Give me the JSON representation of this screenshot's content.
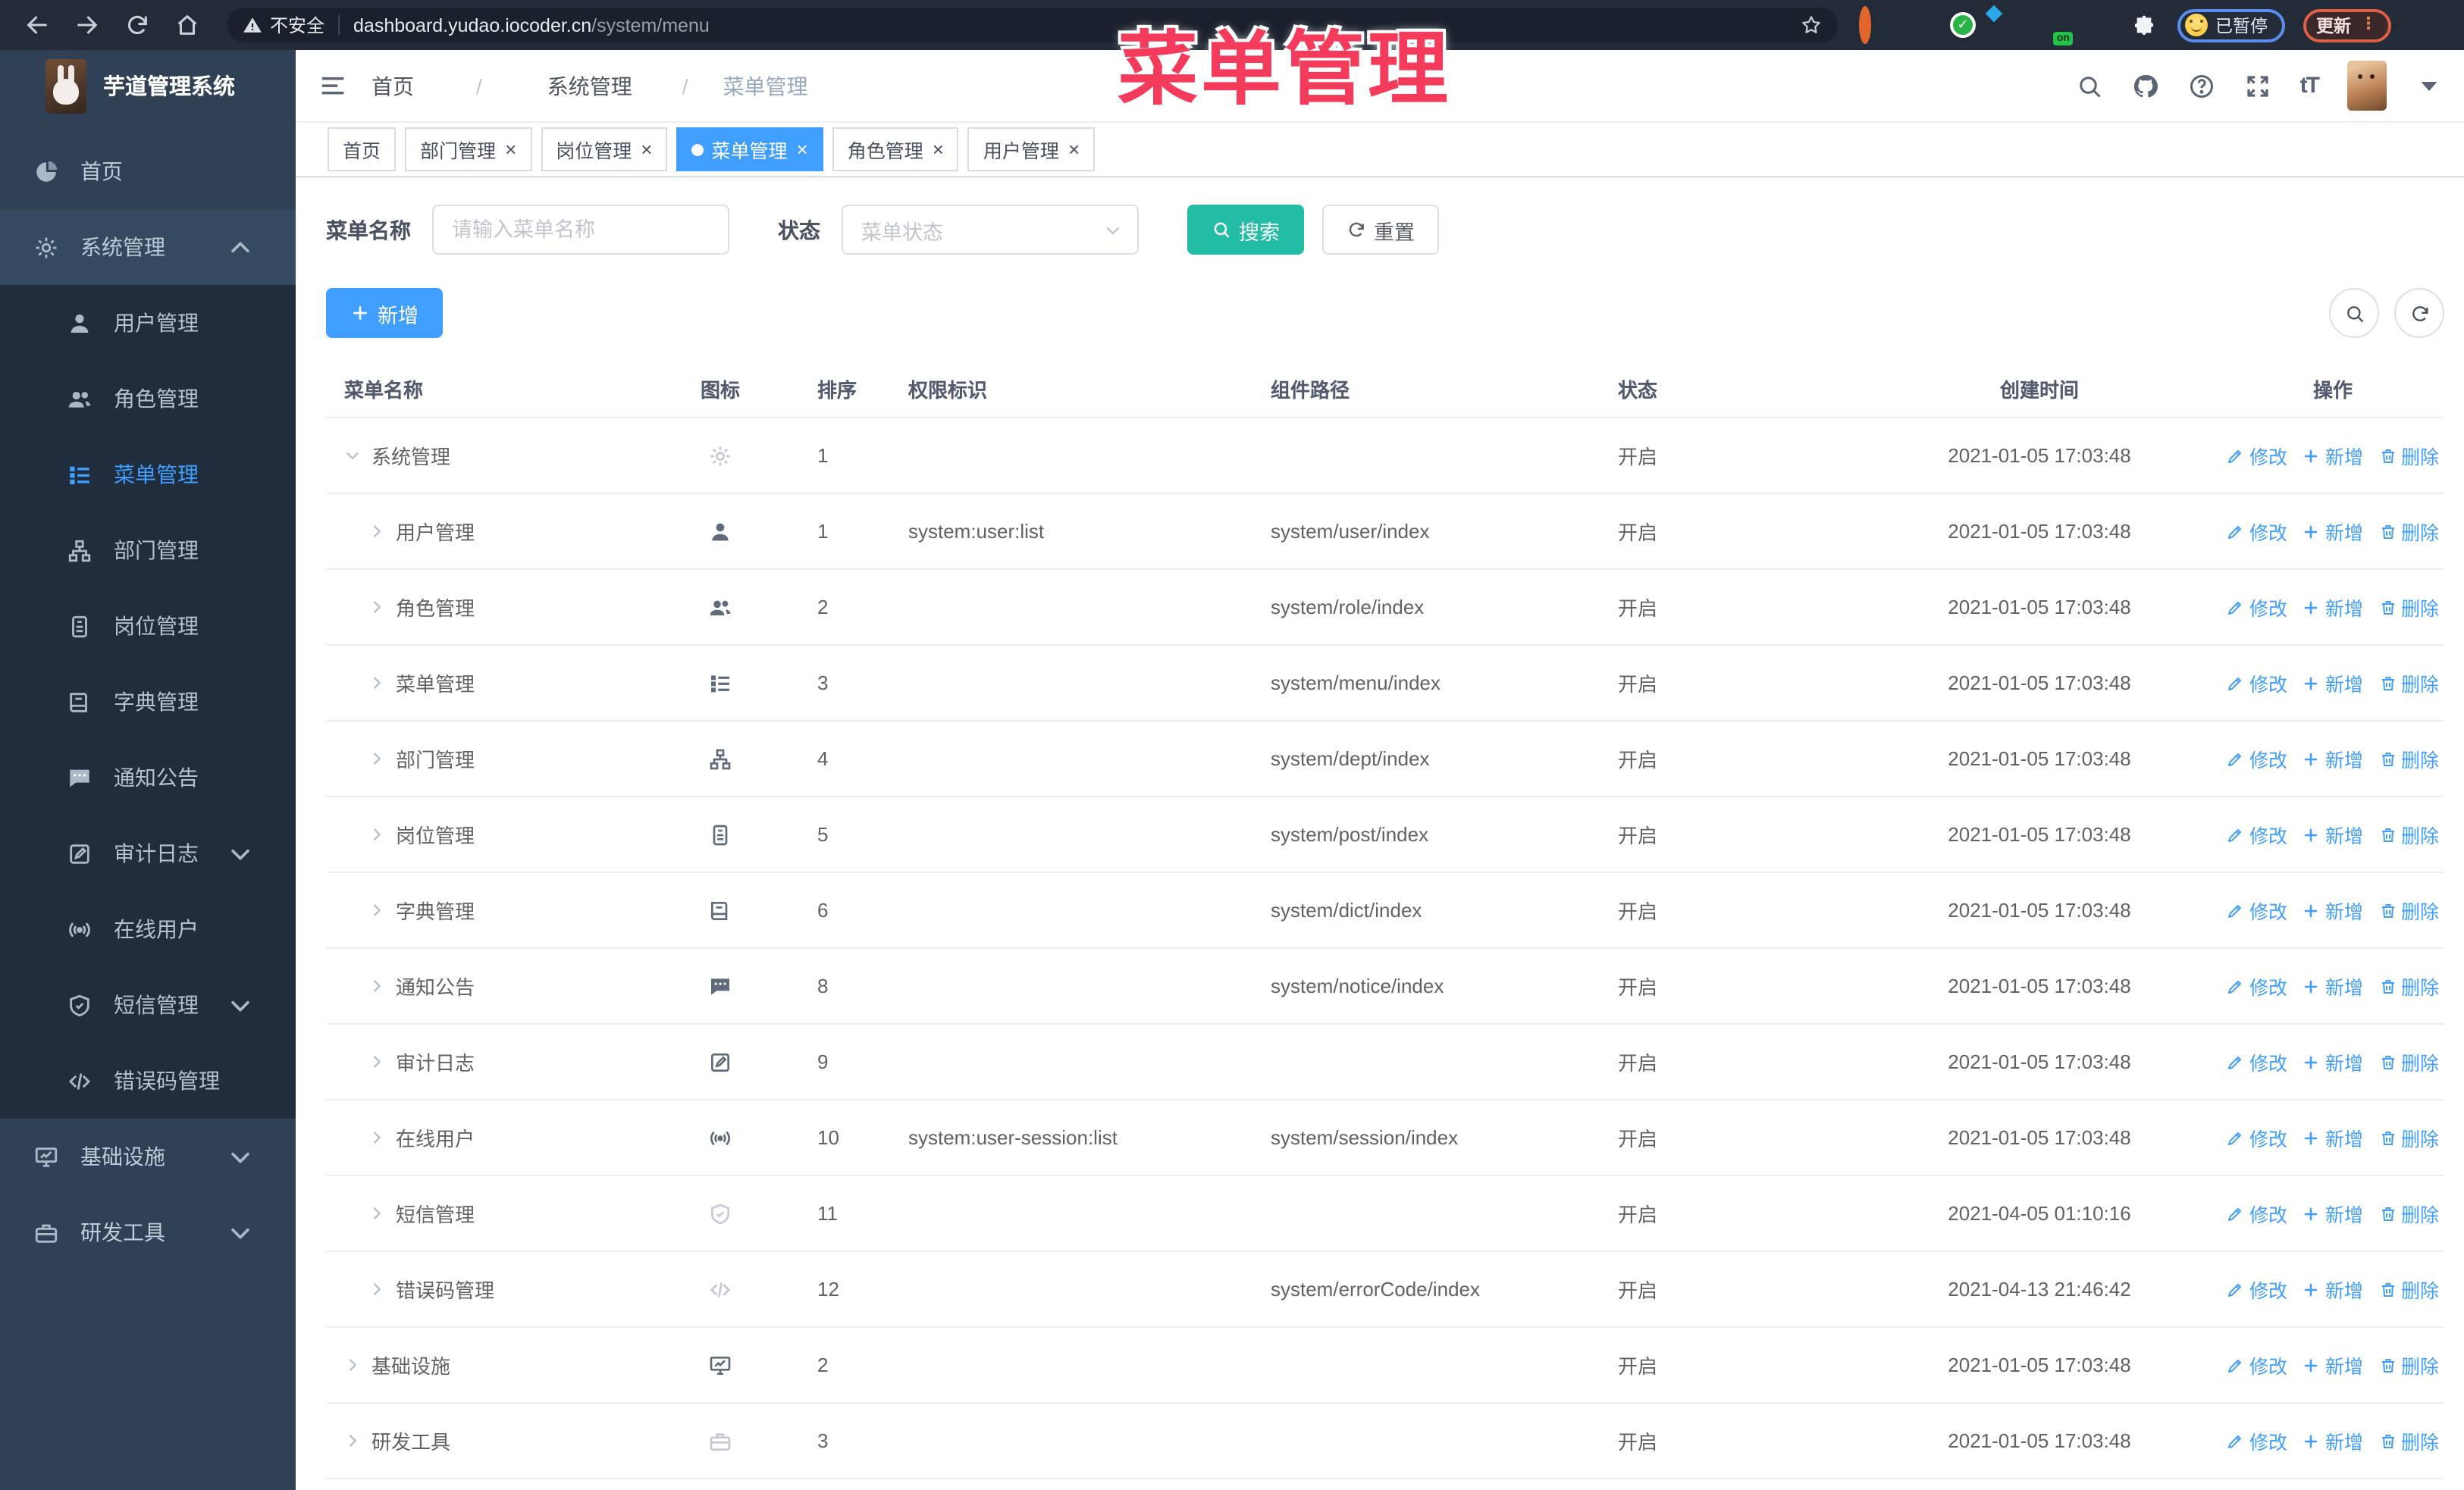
{
  "browser": {
    "security_label": "不安全",
    "url_host": "dashboard.yudao.iocoder.cn",
    "url_path": "/system/menu",
    "ext_on_label": "on",
    "paused_label": "已暂停",
    "update_label": "更新"
  },
  "overlay_title": "菜单管理",
  "app": {
    "logo_title": "芋道管理系统",
    "breadcrumb": [
      "首页",
      "系统管理",
      "菜单管理"
    ]
  },
  "tabs": [
    {
      "label": "首页",
      "closable": false,
      "active": false
    },
    {
      "label": "部门管理",
      "closable": true,
      "active": false
    },
    {
      "label": "岗位管理",
      "closable": true,
      "active": false
    },
    {
      "label": "菜单管理",
      "closable": true,
      "active": true
    },
    {
      "label": "角色管理",
      "closable": true,
      "active": false
    },
    {
      "label": "用户管理",
      "closable": true,
      "active": false
    }
  ],
  "sidebar": {
    "items": [
      {
        "label": "首页",
        "icon": "dashboard",
        "level": 1
      },
      {
        "label": "系统管理",
        "icon": "gear",
        "level": 1,
        "caret": "up",
        "open": true
      },
      {
        "label": "用户管理",
        "icon": "user",
        "level": 2
      },
      {
        "label": "角色管理",
        "icon": "users",
        "level": 2
      },
      {
        "label": "菜单管理",
        "icon": "menu",
        "level": 2,
        "active": true
      },
      {
        "label": "部门管理",
        "icon": "tree",
        "level": 2
      },
      {
        "label": "岗位管理",
        "icon": "badge",
        "level": 2
      },
      {
        "label": "字典管理",
        "icon": "book",
        "level": 2
      },
      {
        "label": "通知公告",
        "icon": "message",
        "level": 2
      },
      {
        "label": "审计日志",
        "icon": "editdoc",
        "level": 2,
        "caret": "down"
      },
      {
        "label": "在线用户",
        "icon": "online",
        "level": 2
      },
      {
        "label": "短信管理",
        "icon": "shield",
        "level": 2,
        "caret": "down"
      },
      {
        "label": "错误码管理",
        "icon": "code",
        "level": 2
      },
      {
        "label": "基础设施",
        "icon": "monitor",
        "level": 1,
        "caret": "down"
      },
      {
        "label": "研发工具",
        "icon": "tool",
        "level": 1,
        "caret": "down"
      }
    ]
  },
  "search": {
    "name_label": "菜单名称",
    "name_placeholder": "请输入菜单名称",
    "status_label": "状态",
    "status_placeholder": "菜单状态",
    "search_label": "搜索",
    "reset_label": "重置"
  },
  "toolbar": {
    "add_label": "新增"
  },
  "table": {
    "columns": [
      "菜单名称",
      "图标",
      "排序",
      "权限标识",
      "组件路径",
      "状态",
      "创建时间",
      "操作"
    ],
    "ops": {
      "edit": "修改",
      "add": "新增",
      "del": "删除"
    },
    "rows": [
      {
        "name": "系统管理",
        "level": 1,
        "expanded": true,
        "icon": "gear",
        "icon_muted": true,
        "sort": "1",
        "perm": "",
        "path": "",
        "status": "开启",
        "time": "2021-01-05 17:03:48"
      },
      {
        "name": "用户管理",
        "level": 2,
        "expanded": false,
        "icon": "user",
        "icon_muted": false,
        "sort": "1",
        "perm": "system:user:list",
        "path": "system/user/index",
        "status": "开启",
        "time": "2021-01-05 17:03:48"
      },
      {
        "name": "角色管理",
        "level": 2,
        "expanded": false,
        "icon": "users",
        "icon_muted": false,
        "sort": "2",
        "perm": "",
        "path": "system/role/index",
        "status": "开启",
        "time": "2021-01-05 17:03:48"
      },
      {
        "name": "菜单管理",
        "level": 2,
        "expanded": false,
        "icon": "menu",
        "icon_muted": false,
        "sort": "3",
        "perm": "",
        "path": "system/menu/index",
        "status": "开启",
        "time": "2021-01-05 17:03:48"
      },
      {
        "name": "部门管理",
        "level": 2,
        "expanded": false,
        "icon": "tree",
        "icon_muted": false,
        "sort": "4",
        "perm": "",
        "path": "system/dept/index",
        "status": "开启",
        "time": "2021-01-05 17:03:48"
      },
      {
        "name": "岗位管理",
        "level": 2,
        "expanded": false,
        "icon": "badge",
        "icon_muted": false,
        "sort": "5",
        "perm": "",
        "path": "system/post/index",
        "status": "开启",
        "time": "2021-01-05 17:03:48"
      },
      {
        "name": "字典管理",
        "level": 2,
        "expanded": false,
        "icon": "book",
        "icon_muted": false,
        "sort": "6",
        "perm": "",
        "path": "system/dict/index",
        "status": "开启",
        "time": "2021-01-05 17:03:48"
      },
      {
        "name": "通知公告",
        "level": 2,
        "expanded": false,
        "icon": "message",
        "icon_muted": false,
        "sort": "8",
        "perm": "",
        "path": "system/notice/index",
        "status": "开启",
        "time": "2021-01-05 17:03:48"
      },
      {
        "name": "审计日志",
        "level": 2,
        "expanded": false,
        "icon": "editdoc",
        "icon_muted": false,
        "sort": "9",
        "perm": "",
        "path": "",
        "status": "开启",
        "time": "2021-01-05 17:03:48"
      },
      {
        "name": "在线用户",
        "level": 2,
        "expanded": false,
        "icon": "online",
        "icon_muted": false,
        "sort": "10",
        "perm": "system:user-session:list",
        "path": "system/session/index",
        "status": "开启",
        "time": "2021-01-05 17:03:48"
      },
      {
        "name": "短信管理",
        "level": 2,
        "expanded": false,
        "icon": "shield",
        "icon_muted": true,
        "sort": "11",
        "perm": "",
        "path": "",
        "status": "开启",
        "time": "2021-04-05 01:10:16"
      },
      {
        "name": "错误码管理",
        "level": 2,
        "expanded": false,
        "icon": "code",
        "icon_muted": true,
        "sort": "12",
        "perm": "",
        "path": "system/errorCode/index",
        "status": "开启",
        "time": "2021-04-13 21:46:42"
      },
      {
        "name": "基础设施",
        "level": 1,
        "expanded": false,
        "icon": "monitor",
        "icon_muted": false,
        "sort": "2",
        "perm": "",
        "path": "",
        "status": "开启",
        "time": "2021-01-05 17:03:48"
      },
      {
        "name": "研发工具",
        "level": 1,
        "expanded": false,
        "icon": "tool",
        "icon_muted": true,
        "sort": "3",
        "perm": "",
        "path": "",
        "status": "开启",
        "time": "2021-01-05 17:03:48"
      }
    ]
  }
}
